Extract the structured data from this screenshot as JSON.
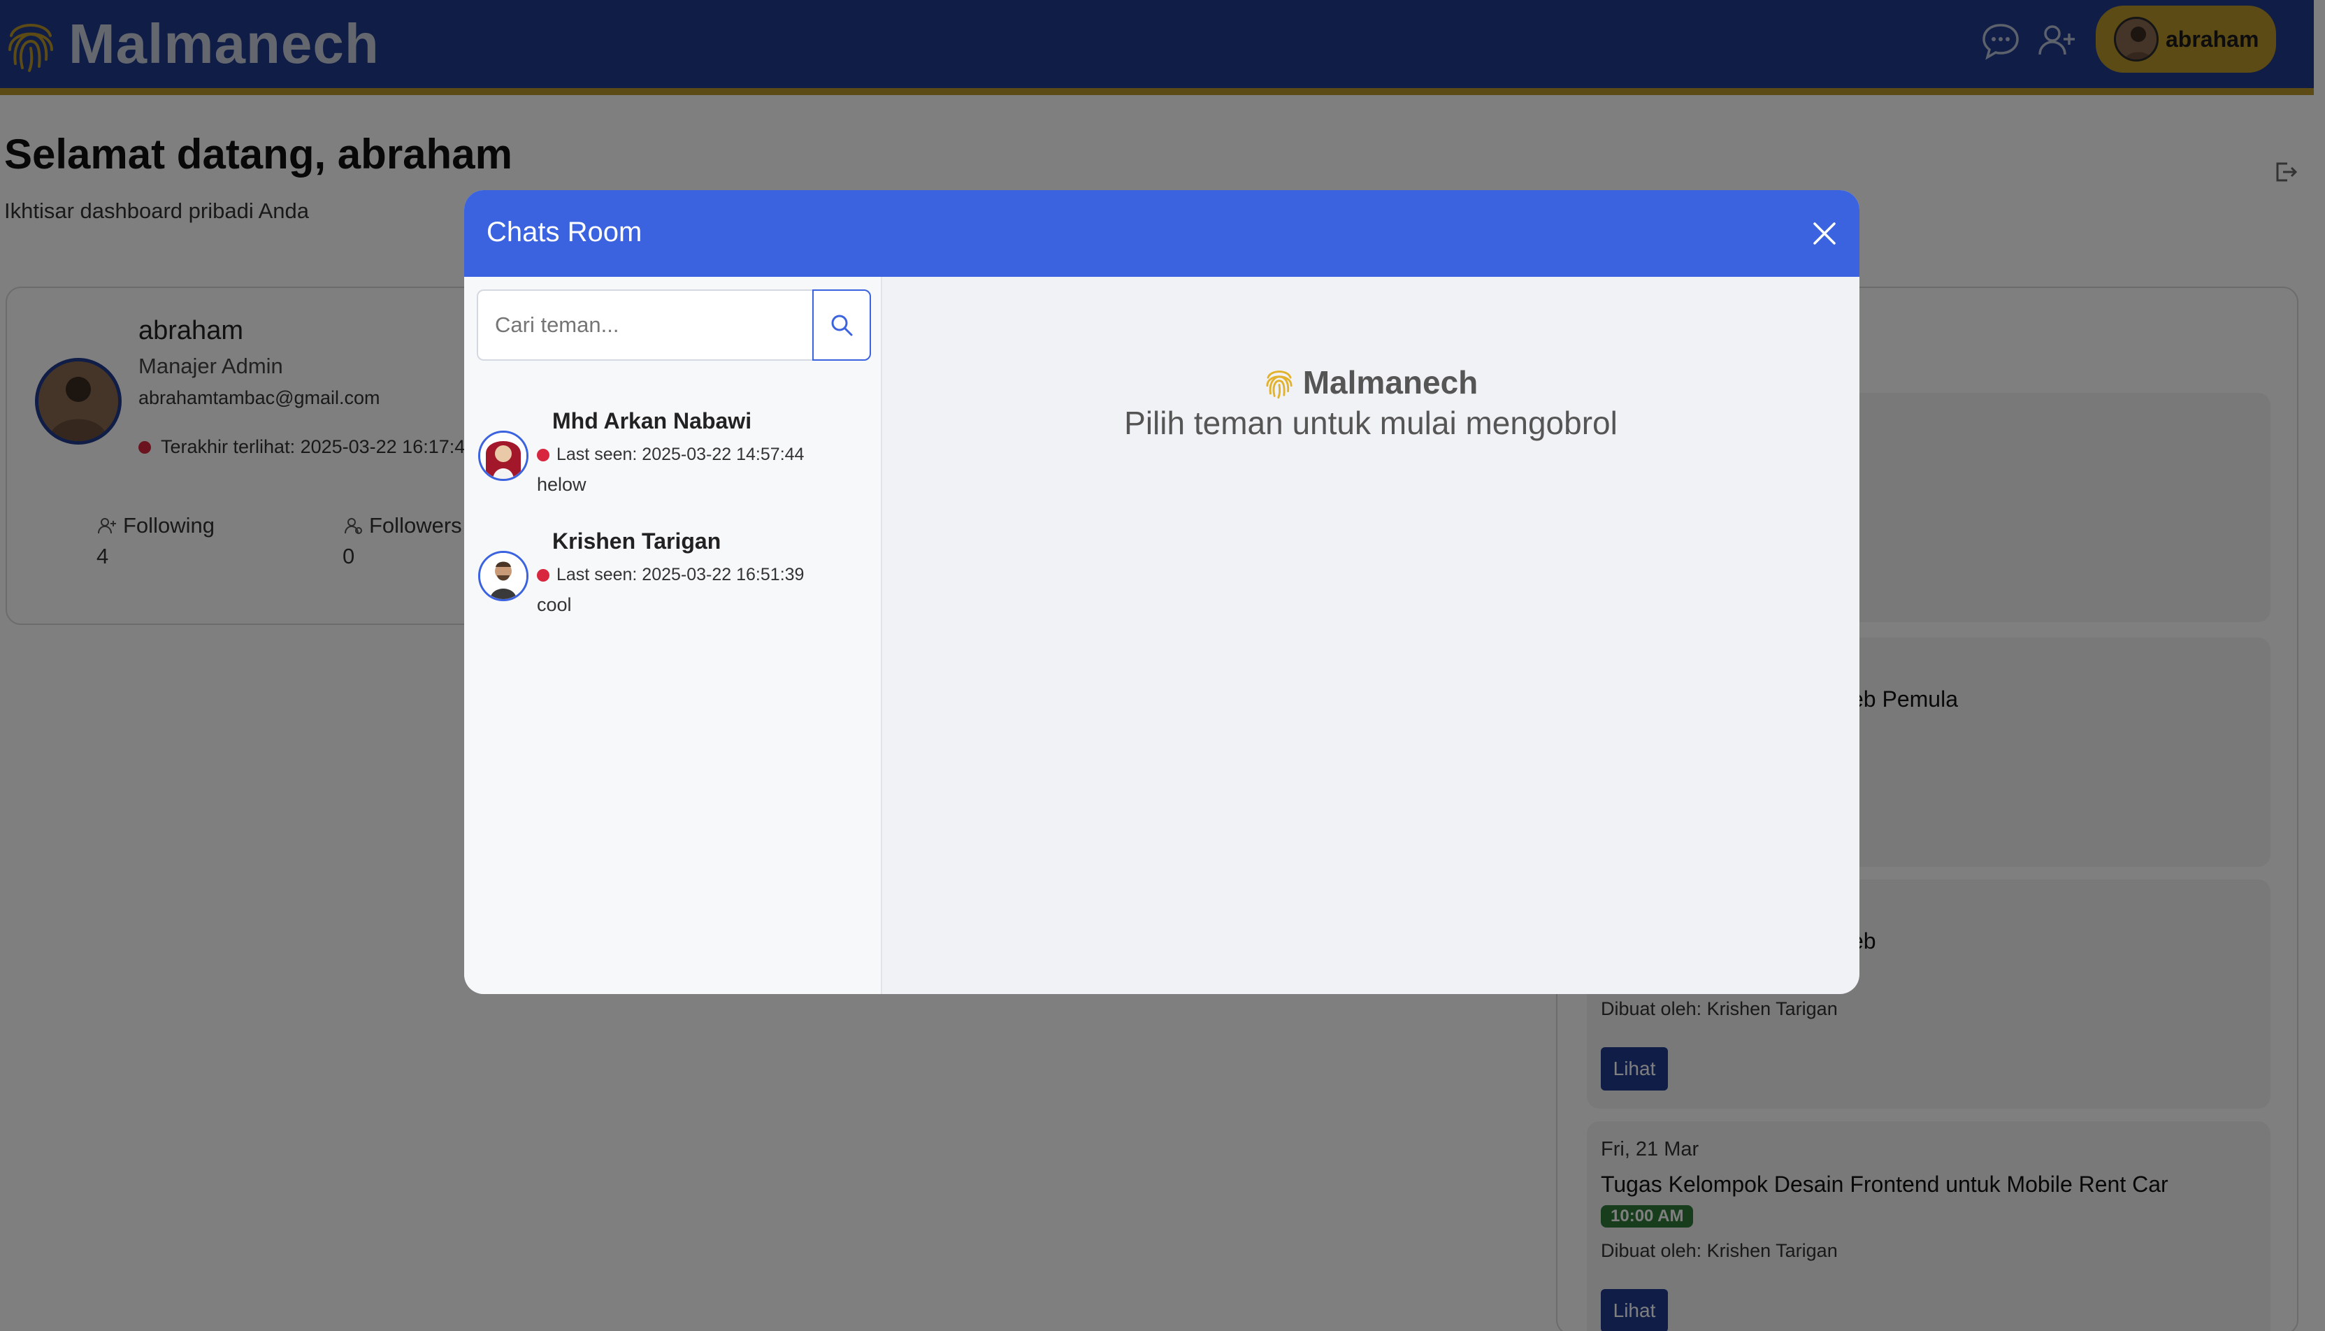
{
  "app": {
    "brand": "Malmanech"
  },
  "nav": {
    "user_name": "abraham"
  },
  "page": {
    "title": "Selamat datang, abraham",
    "subtitle": "Ikhtisar dashboard pribadi Anda"
  },
  "profile": {
    "name": "abraham",
    "role": "Manajer Admin",
    "email": "abrahamtambac@gmail.com",
    "last_seen": "Terakhir terlihat: 2025-03-22 16:17:4",
    "following_label": "Following",
    "following_count": "4",
    "followers_label": "Followers",
    "followers_count": "0"
  },
  "events": [
    {
      "date": "",
      "title": "eb Pemula",
      "time": "",
      "by": "",
      "button": ""
    },
    {
      "date": "",
      "title": "eb",
      "time": "",
      "by": "Dibuat oleh: Krishen Tarigan",
      "button": "Lihat"
    },
    {
      "date": "Fri, 21 Mar",
      "title": "Tugas Kelompok Desain Frontend untuk Mobile Rent Car",
      "time": "10:00 AM",
      "by": "Dibuat oleh: Krishen Tarigan",
      "button": "Lihat"
    }
  ],
  "chat_modal": {
    "title": "Chats Room",
    "search_placeholder": "Cari teman...",
    "friends": [
      {
        "name": "Mhd Arkan Nabawi",
        "last_seen": "Last seen: 2025-03-22 14:57:44",
        "last_message": "helow"
      },
      {
        "name": "Krishen Tarigan",
        "last_seen": "Last seen: 2025-03-22 16:51:39",
        "last_message": "cool"
      }
    ],
    "empty_brand": "Malmanech",
    "empty_prompt": "Pilih teman untuk mulai mengobrol"
  },
  "colors": {
    "navbar": "#1f3a8f",
    "accent_gold": "#b8962a",
    "modal_header": "#3b63e0",
    "offline_dot": "#d7263d",
    "time_badge": "#2f7a3b"
  },
  "icons": [
    "fingerprint-icon",
    "chat-icon",
    "add-user-icon",
    "logout-icon",
    "user-icon",
    "close-icon",
    "search-icon"
  ]
}
